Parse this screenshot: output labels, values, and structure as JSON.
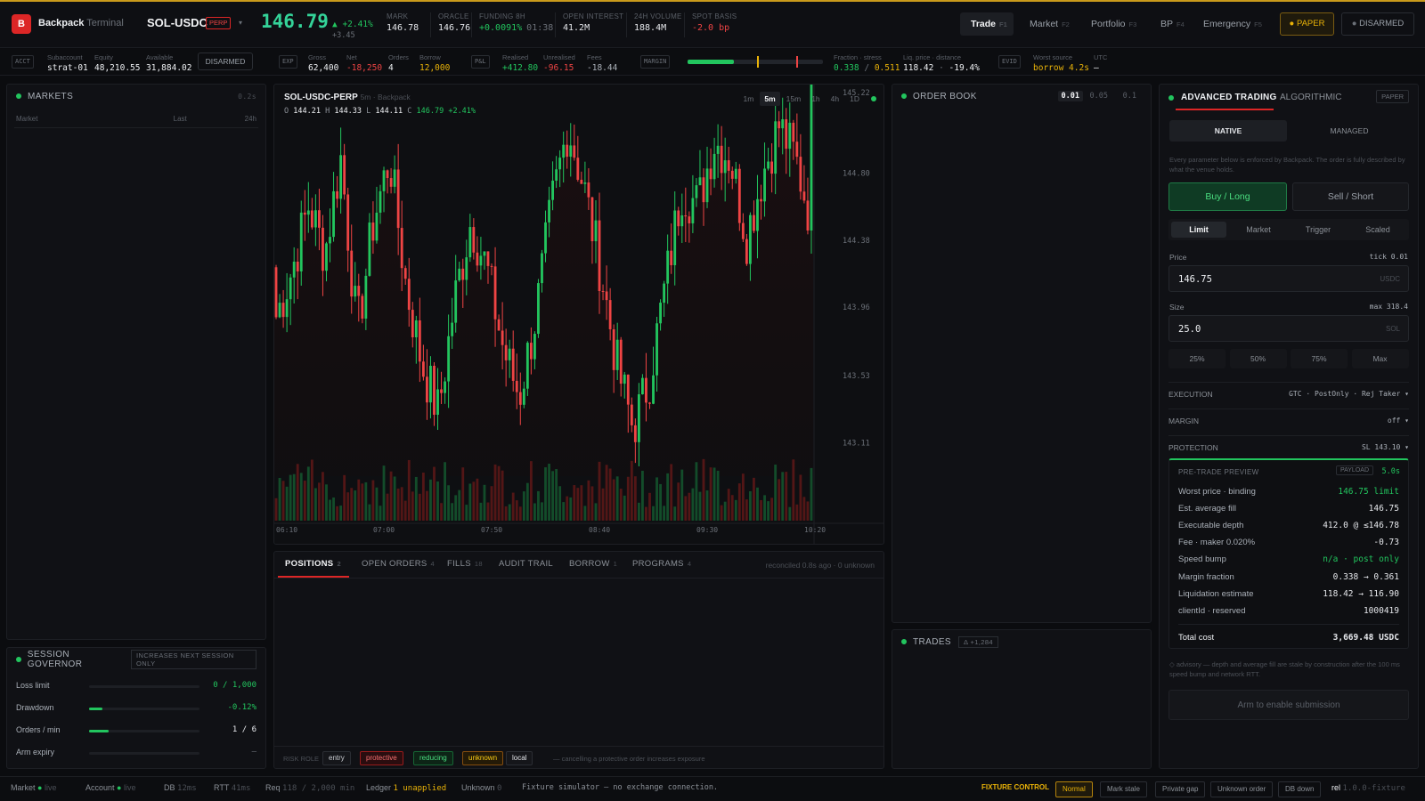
{
  "brand": {
    "logo": "B",
    "name": "Backpack",
    "suffix": "Terminal"
  },
  "symbol": {
    "name": "SOL-USDC",
    "badge": "PERP",
    "price": "146.79",
    "change_pct": "▲ +2.41%",
    "change_abs": "+3.45"
  },
  "stats": [
    {
      "label": "MARK",
      "value": "146.78",
      "color": "white"
    },
    {
      "label": "ORACLE",
      "value": "146.76",
      "color": "white"
    },
    {
      "label": "FUNDING 8H",
      "value": "+0.0091%",
      "extra": "01:38",
      "color": "green"
    },
    {
      "label": "OPEN INTEREST",
      "value": "41.2M",
      "color": "white"
    },
    {
      "label": "24H VOLUME",
      "value": "188.4M",
      "color": "white"
    },
    {
      "label": "SPOT BASIS",
      "value": "-2.0 bp",
      "color": "red"
    }
  ],
  "nav": [
    {
      "label": "Trade",
      "key": "F1"
    },
    {
      "label": "Market",
      "key": "F2"
    },
    {
      "label": "Portfolio",
      "key": "F3"
    },
    {
      "label": "BP",
      "key": "F4"
    },
    {
      "label": "Emergency",
      "key": "F5"
    }
  ],
  "mode": {
    "paper": "PAPER",
    "disarmed": "DISARMED"
  },
  "metrics": {
    "acct_tag": "ACCT",
    "subaccount_label": "Subaccount",
    "subaccount": "strat-01",
    "equity_label": "Equity",
    "equity": "48,210.55",
    "available_label": "Available",
    "available": "31,884.02",
    "disarmed_btn": "DISARMED",
    "exp_tag": "EXP",
    "gross_label": "Gross",
    "gross": "62,400",
    "net_label": "Net",
    "net": "-18,250",
    "orders_label": "Orders",
    "orders": "4",
    "borrow_label": "Borrow",
    "borrow": "12,000",
    "pnl_tag": "P&L",
    "realised_label": "Realised",
    "realised": "+412.80",
    "unrealised_label": "Unrealised",
    "unrealised": "-96.15",
    "fees_label": "Fees",
    "fees": "-18.44",
    "margin_tag": "MARGIN",
    "margin_fill": 0.34,
    "fraction_label": "Fraction · stress",
    "fraction": "0.338",
    "stress": "0.511",
    "liq_label": "Liq. price · distance",
    "liq": "118.42",
    "distance": "-19.4%",
    "evid_tag": "EVID",
    "worst_label": "Worst source",
    "worst": "borrow 4.2s",
    "utc_label": "UTC",
    "utc": "—"
  },
  "markets": {
    "title": "MARKETS",
    "age": "0.2s",
    "col_market": "Market",
    "col_last": "Last",
    "col_24h": "24h"
  },
  "governor": {
    "title": "SESSION GOVERNOR",
    "note": "INCREASES NEXT SESSION ONLY",
    "rows": [
      {
        "label": "Loss limit",
        "value": "0 / 1,000",
        "fill": 0,
        "color": "green"
      },
      {
        "label": "Drawdown",
        "value": "-0.12%",
        "fill": 0.12,
        "color": "green"
      },
      {
        "label": "Orders / min",
        "value": "1 / 6",
        "fill": 0.18,
        "color": "white"
      },
      {
        "label": "Arm expiry",
        "value": "—",
        "fill": 0,
        "color": "muted"
      }
    ]
  },
  "chart": {
    "symbol": "SOL-USDC-PERP",
    "meta": "5m · Backpack",
    "o": "144.21",
    "h": "144.33",
    "l": "144.11",
    "c": "146.79",
    "chg": "+2.41%",
    "intervals": [
      "1m",
      "5m",
      "15m",
      "1h",
      "4h",
      "1D"
    ],
    "active_interval": "5m",
    "price_ticks": [
      "144.80",
      "144.38",
      "143.96",
      "143.53",
      "143.11"
    ],
    "top_tick": "145.22",
    "time_ticks": [
      "06:10",
      "07:00",
      "07:50",
      "08:40",
      "09:30",
      "10:20"
    ]
  },
  "chart_data": {
    "type": "candlestick",
    "title": "SOL-USDC-PERP",
    "open": 144.21,
    "high": 144.33,
    "low": 144.11,
    "close": 146.79,
    "ylim": [
      142.9,
      145.3
    ],
    "x": [
      "06:10",
      "07:00",
      "07:50",
      "08:40",
      "09:30",
      "10:20"
    ],
    "closes": [
      143.9,
      144.2,
      144.6,
      144.3,
      144.9,
      143.8,
      144.5,
      144.9,
      144.1,
      143.6,
      143.3,
      144.0,
      144.5,
      144.2,
      143.7,
      143.4,
      143.9,
      144.6,
      145.1,
      144.7,
      144.2,
      143.6,
      143.2,
      143.5,
      144.1,
      144.7,
      144.6,
      145.0,
      144.9,
      144.4,
      144.8,
      145.1,
      144.9,
      144.5
    ]
  },
  "bottom_tabs": [
    {
      "label": "POSITIONS",
      "count": "2"
    },
    {
      "label": "OPEN ORDERS",
      "count": "4"
    },
    {
      "label": "FILLS",
      "count": "18"
    },
    {
      "label": "AUDIT TRAIL",
      "count": ""
    },
    {
      "label": "BORROW",
      "count": "1"
    },
    {
      "label": "PROGRAMS",
      "count": "4"
    }
  ],
  "reconciled": "reconciled 0.8s ago · 0 unknown",
  "risk": {
    "label": "RISK ROLE",
    "pills": [
      "entry",
      "protective",
      "reducing",
      "unknown",
      "local"
    ],
    "note": "— cancelling a protective order increases exposure"
  },
  "orderbook": {
    "title": "ORDER BOOK",
    "ticks": [
      "0.01",
      "0.05",
      "0.1"
    ]
  },
  "trades": {
    "title": "TRADES",
    "badge": "Δ +1,284"
  },
  "ticket": {
    "tab_adv": "ADVANCED TRADING",
    "tab_algo": "ALGORITHMIC",
    "paper": "PAPER",
    "native": "NATIVE",
    "managed": "MANAGED",
    "desc": "Every parameter below is enforced by Backpack. The order is fully described by what the venue holds.",
    "buy": "Buy / Long",
    "sell": "Sell / Short",
    "types": [
      "Limit",
      "Market",
      "Trigger",
      "Scaled"
    ],
    "price_label": "Price",
    "price_hint": "tick 0.01",
    "price": "146.75",
    "price_unit": "USDC",
    "size_label": "Size",
    "size_hint": "max 318.4",
    "size": "25.0",
    "size_unit": "SOL",
    "pcts": [
      "25%",
      "50%",
      "75%",
      "Max"
    ],
    "execution_label": "EXECUTION",
    "execution": "GTC · PostOnly · Rej Taker",
    "margin_label": "MARGIN",
    "margin": "off",
    "protection_label": "PROTECTION",
    "protection": "SL 143.10",
    "preview_title": "PRE-TRADE PREVIEW",
    "payload": "PAYLOAD",
    "preview_age": "5.0s",
    "preview": [
      {
        "label": "Worst price · binding",
        "value": "146.75 limit",
        "color": "green"
      },
      {
        "label": "Est. average fill",
        "value": "146.75",
        "color": "white"
      },
      {
        "label": "Executable depth",
        "value": "412.0 @ ≤146.78",
        "color": "white"
      },
      {
        "label": "Fee · maker 0.020%",
        "value": "-0.73",
        "color": "white"
      },
      {
        "label": "Speed bump",
        "value": "n/a · post only",
        "color": "green"
      },
      {
        "label": "Margin fraction",
        "value": "0.338 → 0.361",
        "color": "white"
      },
      {
        "label": "Liquidation estimate",
        "value": "118.42 → 116.90",
        "color": "white"
      },
      {
        "label": "clientId · reserved",
        "value": "1000419",
        "color": "white"
      }
    ],
    "total_label": "Total cost",
    "total": "3,669.48 USDC",
    "advisory": "◇ advisory — depth and average fill are stale by construction after the 100 ms speed bump and network RTT.",
    "arm": "Arm to enable submission"
  },
  "status": {
    "market": "Market",
    "market_state": "live",
    "account": "Account",
    "account_state": "live",
    "db": "DB",
    "db_val": "12ms",
    "rtt": "RTT",
    "rtt_val": "41ms",
    "req": "Req",
    "req_val": "118 / 2,000 min",
    "ledger": "Ledger",
    "ledger_val": "1 unapplied",
    "unknown": "Unknown",
    "unknown_val": "0",
    "fixture": "Fixture simulator — no exchange connection.",
    "fixture_control": "FIXTURE CONTROL",
    "fixture_btns": [
      "Normal",
      "Mark stale",
      "Private gap",
      "Unknown order",
      "DB down"
    ],
    "rel": "rel",
    "rel_val": "1.0.0-fixture"
  },
  "colors": {
    "green": "#22c55e",
    "red": "#ef4444",
    "amber": "#eab308",
    "bg": "#0b0c0f",
    "panel": "#101115"
  }
}
